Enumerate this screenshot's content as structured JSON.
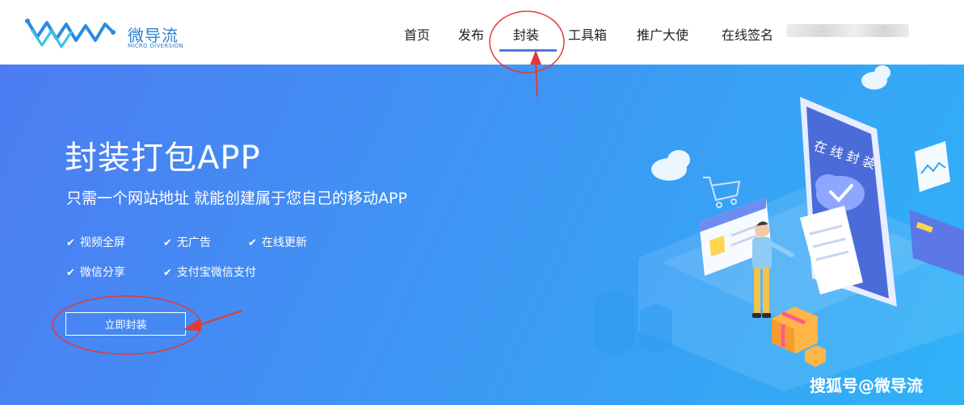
{
  "brand": {
    "name_cn": "微导流",
    "name_en": "MICRO DIVERSION"
  },
  "nav": {
    "items": [
      {
        "label": "首页"
      },
      {
        "label": "发布"
      },
      {
        "label": "封装"
      },
      {
        "label": "工具箱"
      },
      {
        "label": "推广大使"
      },
      {
        "label": "在线签名"
      }
    ],
    "active": "封装"
  },
  "hero": {
    "title": "封装打包APP",
    "subtitle": "只需一个网站地址 就能创建属于您自己的移动APP",
    "features": [
      {
        "label": "视频全屏"
      },
      {
        "label": "无广告"
      },
      {
        "label": "在线更新"
      },
      {
        "label": "微信分享"
      },
      {
        "label": "支付宝微信支付"
      }
    ],
    "cta_label": "立即封装",
    "illustration_text": "在 线 封 装"
  },
  "watermark": "搜狐号@微导流",
  "colors": {
    "accent": "#4a79e8",
    "hero_start": "#4d7cf2",
    "hero_end": "#2fb2f6",
    "annotation": "#e53935"
  }
}
